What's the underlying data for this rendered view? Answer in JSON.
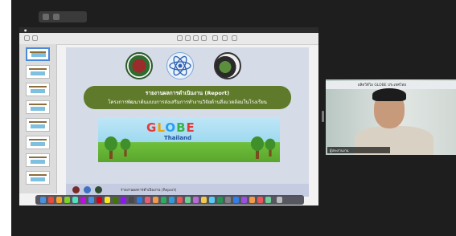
{
  "slide": {
    "title_line1": "รายงานผลการดำเนินงาน (Report)",
    "title_line2": "โครงการพัฒนาต้นแบบการส่งเสริมการทำงานวิจัยด้านสิ่งแวดล้อมในโรงเรียน",
    "banner_word": [
      "G",
      "L",
      "O",
      "B",
      "E"
    ],
    "banner_sub": "Thailand",
    "footer_text": "รายงานผลการดำเนินงาน (Report)"
  },
  "participant": {
    "header_text": "ผลิตวิดีโอ GLOBE ประเทศไทย",
    "caption": "ผู้ประสานงาน"
  },
  "colors": {
    "title_band": "#5e7a2a",
    "slide_bg": "#d6dbe8",
    "stage_bg": "#1e1e1e"
  }
}
